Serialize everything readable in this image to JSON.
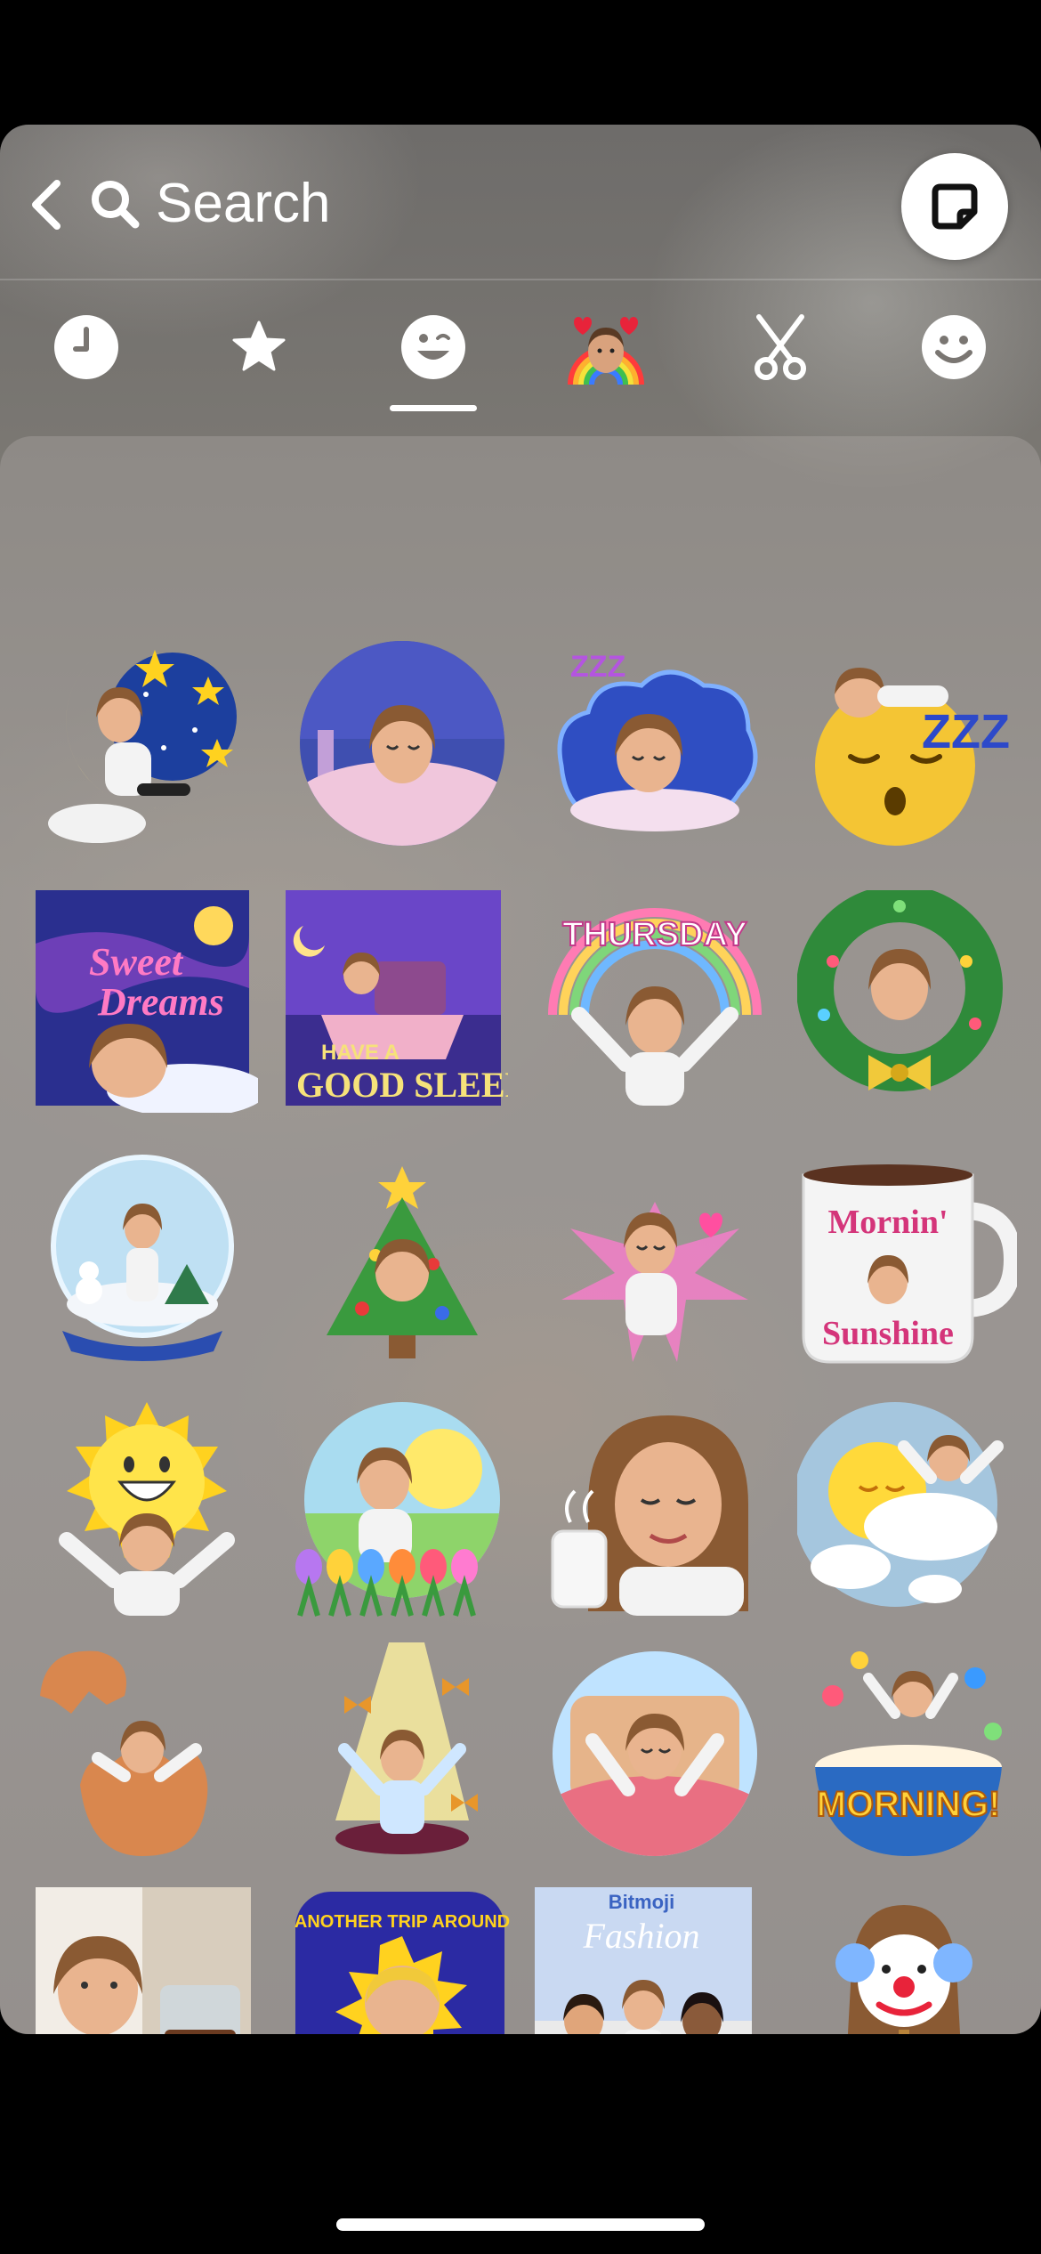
{
  "search": {
    "label": "Search"
  },
  "tabs": [
    {
      "name": "recents",
      "icon": "clock-icon"
    },
    {
      "name": "favorites",
      "icon": "star-icon"
    },
    {
      "name": "bitmoji",
      "icon": "bitmoji-face-icon",
      "selected": true
    },
    {
      "name": "friendmoji",
      "icon": "avatar-hearts-icon"
    },
    {
      "name": "cutouts",
      "icon": "scissors-icon"
    },
    {
      "name": "emoji",
      "icon": "smiley-icon"
    }
  ],
  "stickers": [
    {
      "id": "moon-stars",
      "text": ""
    },
    {
      "id": "bed-night-circle",
      "text": ""
    },
    {
      "id": "sleeping-cloud-zzz",
      "text": "ZZZ"
    },
    {
      "id": "sleepy-emoji-zzz",
      "text": "ZZZ"
    },
    {
      "id": "sweet-dreams-card",
      "text": "Sweet Dreams"
    },
    {
      "id": "good-sleep-card",
      "text": "HAVE A GOOD SLEEP"
    },
    {
      "id": "thursday-rainbow",
      "text": "THURSDAY"
    },
    {
      "id": "holiday-wreath",
      "text": ""
    },
    {
      "id": "snow-globe",
      "text": ""
    },
    {
      "id": "christmas-tree",
      "text": ""
    },
    {
      "id": "pink-burst",
      "text": ""
    },
    {
      "id": "mornin-sunshine-mug",
      "text": "Mornin' Sunshine"
    },
    {
      "id": "sun-smile-arms",
      "text": ""
    },
    {
      "id": "tulips-morning",
      "text": ""
    },
    {
      "id": "coffee-face",
      "text": ""
    },
    {
      "id": "sun-clouds",
      "text": ""
    },
    {
      "id": "egg-hatch",
      "text": ""
    },
    {
      "id": "light-beam-butterflies",
      "text": ""
    },
    {
      "id": "bed-wake-circle",
      "text": ""
    },
    {
      "id": "cereal-morning",
      "text": "MORNING!"
    },
    {
      "id": "coffee-maker",
      "text": ""
    },
    {
      "id": "trip-around-sun",
      "text": "ANOTHER TRIP AROUND THE SUN!"
    },
    {
      "id": "bitmoji-fashion",
      "text": "Bitmoji Fashion NEW ARRIVALS"
    },
    {
      "id": "clown-earmuffs",
      "text": ""
    }
  ],
  "colors": {
    "accent": "#ffffff",
    "panel": "#85817e",
    "skin": "#e9b48f",
    "hair": "#8a5a33",
    "pajama": "#f3f3f3"
  }
}
